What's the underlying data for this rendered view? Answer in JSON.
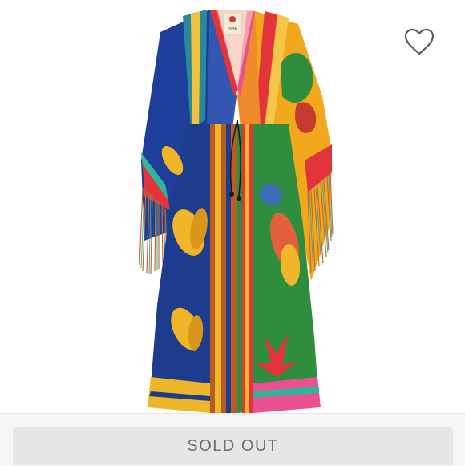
{
  "product": {
    "image_icon": "dress-photo",
    "brand_tag_text": "FARM",
    "colors": {
      "sleeve_left": "#1d3f9a",
      "sleeve_right": "#f2a81d",
      "skirt_left": "#1e3c8e",
      "skirt_right": "#2f8d3e",
      "stripe_red": "#e2343a",
      "stripe_pink": "#e9508f",
      "banana_yellow": "#f0b62a"
    }
  },
  "actions": {
    "like_icon": "heart-outline-icon",
    "sold_out_label": "SOLD OUT"
  }
}
